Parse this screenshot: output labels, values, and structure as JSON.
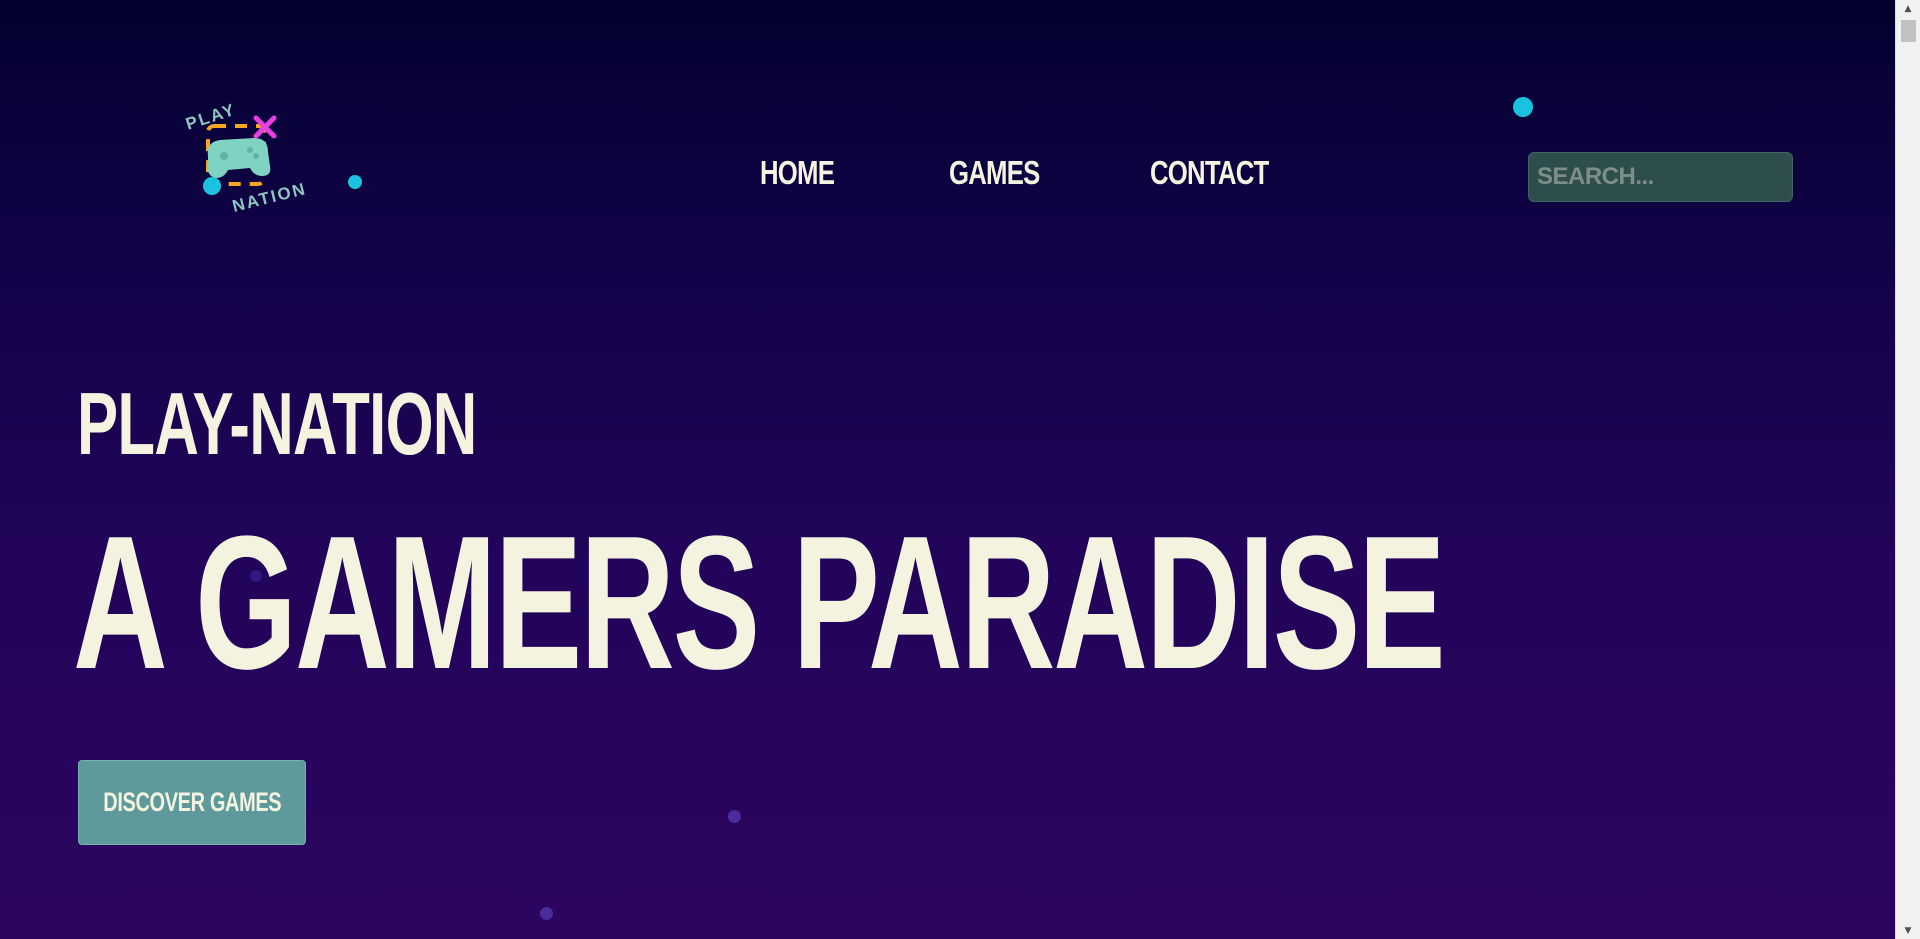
{
  "logo": {
    "top_text": "PLAY",
    "bottom_text": "NATION"
  },
  "nav": {
    "items": [
      {
        "label": "HOME"
      },
      {
        "label": "GAMES"
      },
      {
        "label": "CONTACT"
      }
    ]
  },
  "search": {
    "placeholder": "SEARCH...",
    "value": ""
  },
  "hero": {
    "subtitle": "PLAY-NATION",
    "title": "A GAMERS PARADISE",
    "cta_label": "DISCOVER GAMES"
  },
  "colors": {
    "background_top": "#03012f",
    "background_bottom": "#2c0560",
    "text": "#f4f3df",
    "accent_cyan": "#19c3e0",
    "button": "#5e9a9c",
    "search_bg": "#2e4d4d"
  },
  "icons": {
    "logo_controller": "gamepad-icon",
    "logo_cross": "cross-icon",
    "scroll_up": "chevron-up-icon",
    "scroll_down": "chevron-down-icon"
  }
}
